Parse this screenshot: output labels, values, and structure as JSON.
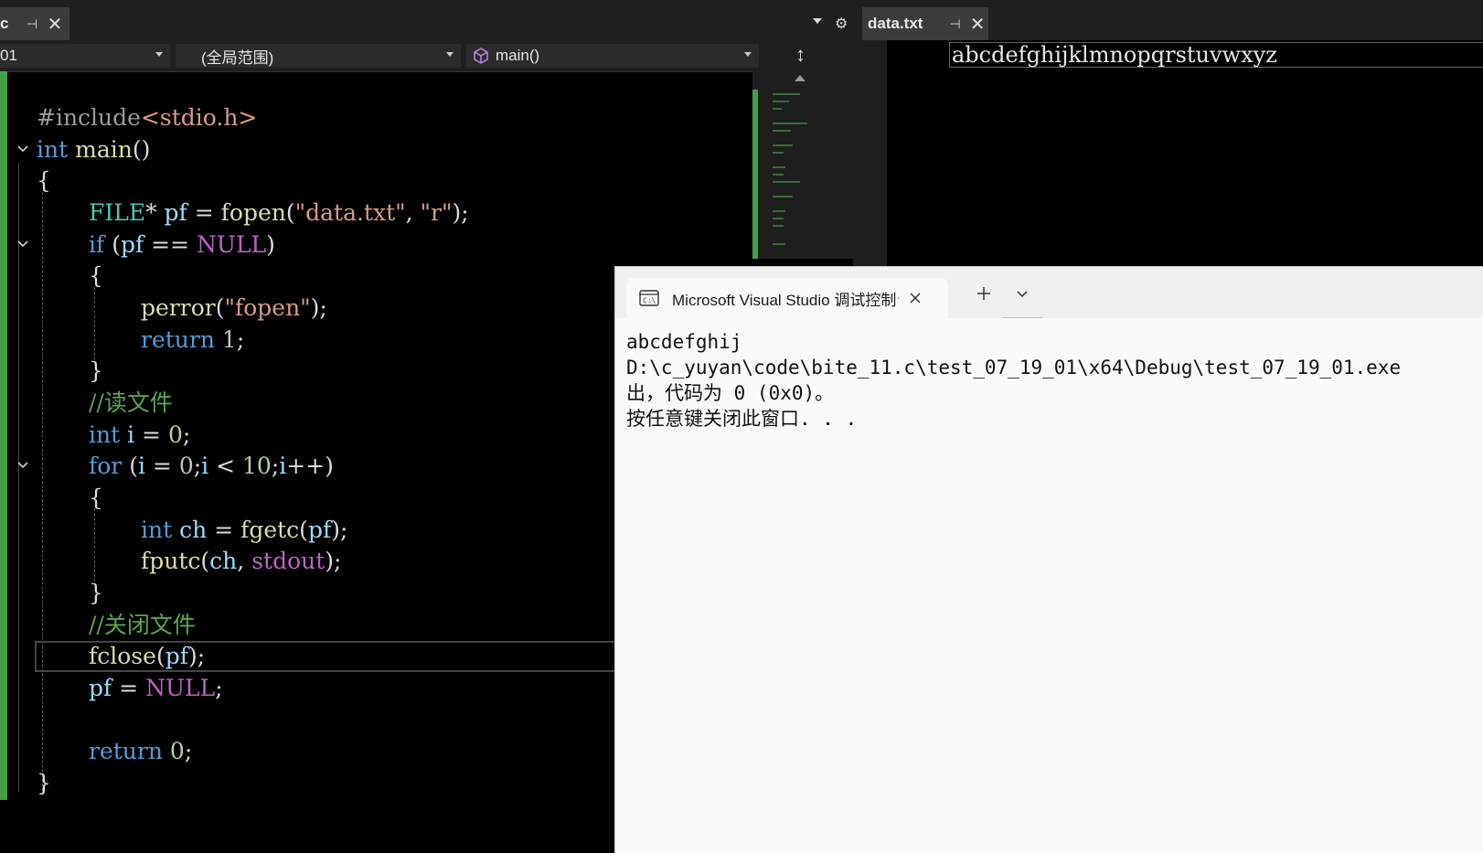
{
  "editor": {
    "tab": {
      "name": "c"
    },
    "nav": {
      "project": "01",
      "scope": "(全局范围)",
      "function": "main()"
    },
    "code": {
      "l1_pp": "#include",
      "l1_hdr": "<stdio.h>",
      "l2_kw": "int",
      "l2_fn": "main",
      "l2_rest": "()",
      "l3": "{",
      "l4_ty": "FILE",
      "l4_a": "* ",
      "l4_va": "pf",
      "l4_b": " = ",
      "l4_fn": "fopen",
      "l4_c": "(",
      "l4_s1": "\"data.txt\"",
      "l4_d": ", ",
      "l4_s2": "\"r\"",
      "l4_e": ");",
      "l5_kw": "if",
      "l5_a": " (",
      "l5_va": "pf",
      "l5_b": " == ",
      "l5_mc": "NULL",
      "l5_c": ")",
      "l6": "{",
      "l7_fn": "perror",
      "l7_a": "(",
      "l7_s": "\"fopen\"",
      "l7_b": ");",
      "l8_kw": "return",
      "l8_num": "1",
      "l8_b": ";",
      "l9": "}",
      "l10_cm": "//读文件",
      "l11_kw": "int",
      "l11_va": "i",
      "l11_a": " = ",
      "l11_num": "0",
      "l11_b": ";",
      "l12_kw": "for",
      "l12_a": " (",
      "l12_va1": "i",
      "l12_b": " = ",
      "l12_num1": "0",
      "l12_c": ";",
      "l12_va2": "i",
      "l12_d": " < ",
      "l12_num2": "10",
      "l12_e": ";",
      "l12_va3": "i",
      "l12_f": "++)",
      "l13": "{",
      "l14_kw": "int",
      "l14_va": "ch",
      "l14_a": " = ",
      "l14_fn": "fgetc",
      "l14_b": "(",
      "l14_va2": "pf",
      "l14_c": ");",
      "l15_fn": "fputc",
      "l15_a": "(",
      "l15_va": "ch",
      "l15_b": ", ",
      "l15_mc": "stdout",
      "l15_c": ");",
      "l16": "}",
      "l17_cm": "//关闭文件",
      "l18_fn": "fclose",
      "l18_a": "(",
      "l18_va": "pf",
      "l18_b": ");",
      "l19_va": "pf",
      "l19_a": " = ",
      "l19_mc": "NULL",
      "l19_b": ";",
      "l21_kw": "return",
      "l21_num": "0",
      "l21_b": ";",
      "l22": "}"
    }
  },
  "doc": {
    "tab": {
      "name": "data.txt"
    },
    "content": "abcdefghijklmnopqrstuvwxyz"
  },
  "terminal": {
    "title": "Microsoft Visual Studio 调试控制台",
    "lines": [
      "abcdefghij",
      "D:\\c_yuyan\\code\\bite_11.c\\test_07_19_01\\x64\\Debug\\test_07_19_01.exe",
      "出，代码为 0 (0x0)。",
      "按任意键关闭此窗口. . ."
    ]
  },
  "colors": {
    "keyword": "#569cd6",
    "type": "#4ec9b0",
    "function": "#dcdcaa",
    "variable": "#9cdcfe",
    "string": "#d69d85",
    "number": "#b5cea8",
    "comment": "#57a64a",
    "macro": "#bd63c5",
    "change_bar": "#43a047"
  }
}
